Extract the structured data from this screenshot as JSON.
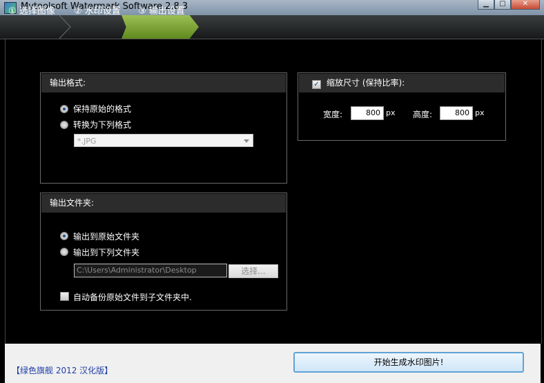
{
  "window": {
    "title": "Mytoolsoft Watermark Software 2.8.3",
    "minimize": "▁",
    "maximize": "□",
    "close": "✕"
  },
  "tabs": [
    {
      "label": "① 选择图像",
      "active": false
    },
    {
      "label": "② 水印设置",
      "active": false
    },
    {
      "label": "③ 输出设置",
      "active": true
    }
  ],
  "format_panel": {
    "title": "输出格式:",
    "option_keep": "保持原始的格式",
    "option_convert": "转换为下列格式",
    "selected": "keep",
    "format_value": "*.JPG"
  },
  "folder_panel": {
    "title": "输出文件夹:",
    "option_original": "输出到原始文件夹",
    "option_custom": "输出到下列文件夹",
    "selected": "original",
    "path_value": "C:\\Users\\Administrator\\Desktop",
    "browse_label": "选择...",
    "backup_label": "自动备份原始文件到子文件夹中.",
    "backup_checked": false
  },
  "resize_panel": {
    "title": "缩放尺寸 (保持比率):",
    "enabled": true,
    "width_label": "宽度:",
    "width_value": "800",
    "width_unit": "px",
    "height_label": "高度:",
    "height_value": "800",
    "height_unit": "px"
  },
  "footer": {
    "link_label": "【绿色旗舰 2012 汉化版】",
    "start_label": "开始生成水印图片!"
  },
  "colors": {
    "active_tab": "#7fa834",
    "footer_link": "#1e3ea8",
    "start_border": "#5fa3d6"
  }
}
